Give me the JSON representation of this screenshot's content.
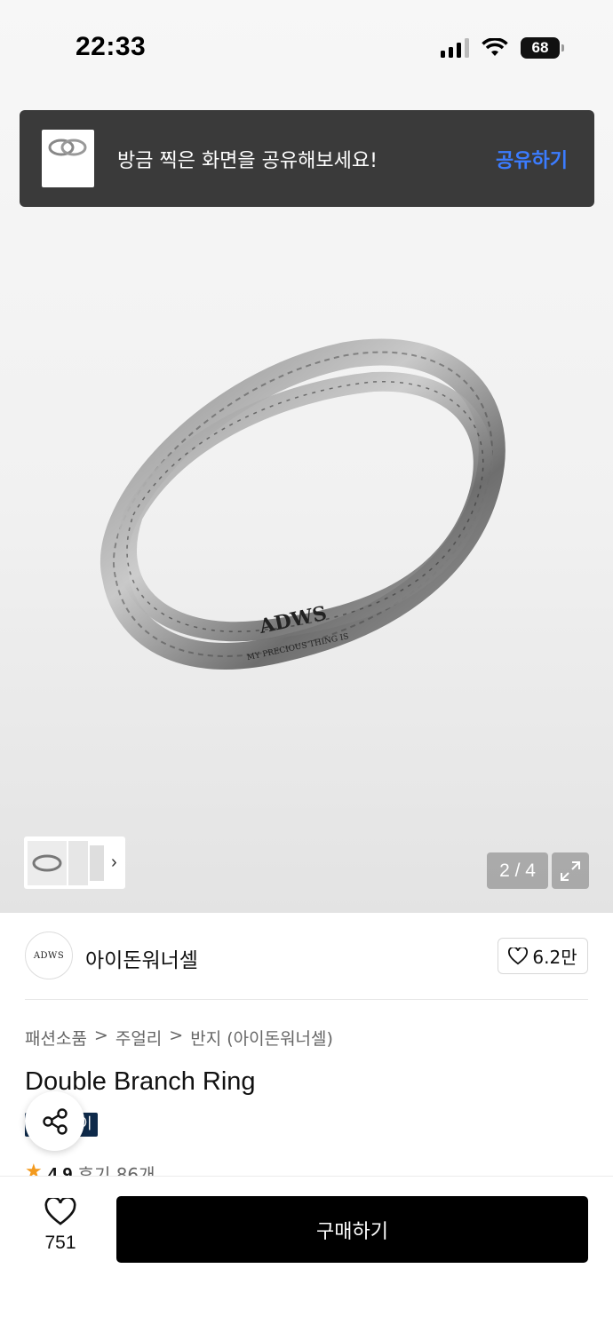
{
  "status_bar": {
    "time": "22:33",
    "battery": "68"
  },
  "toast": {
    "message": "방금 찍은 화면을 공유해보세요!",
    "action": "공유하기"
  },
  "gallery": {
    "counter": "2 / 4",
    "ring_engraving": "ADWS",
    "ring_inner_text": "MY PRECIOUS THING IS"
  },
  "brand": {
    "logo_text": "ADWS",
    "name": "아이돈워너셀",
    "likes": "6.2만"
  },
  "breadcrumb": {
    "items": [
      "패션소품",
      "주얼리",
      "반지 (아이돈워너셀)"
    ],
    "separator": ">"
  },
  "product": {
    "title": "Double Branch Ring",
    "badge": "이"
  },
  "rating": {
    "score": "4.9",
    "reviews": "후기 86개"
  },
  "bottom_bar": {
    "wish_count": "751",
    "buy_label": "구매하기"
  },
  "colors": {
    "toast_bg": "#3a3a3a",
    "toast_action": "#3b7cff",
    "buy_button": "#000000",
    "badge_bg": "#0e2a4a",
    "star": "#f39a1e"
  },
  "icons": [
    "signal-icon",
    "wifi-icon",
    "battery-icon",
    "heart-icon",
    "expand-icon",
    "share-icon",
    "chevron-right-icon",
    "star-icon"
  ]
}
